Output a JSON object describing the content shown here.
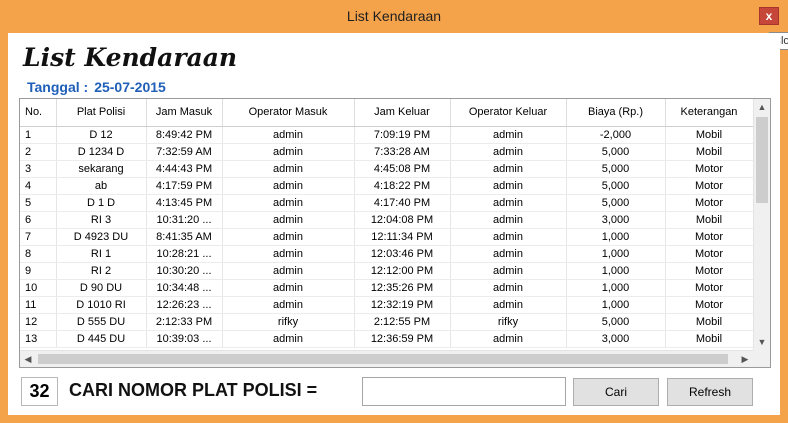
{
  "window": {
    "title": "List Kendaraan",
    "close_glyph": "x",
    "tooltip_fragment": "Clo"
  },
  "header": {
    "heading": "List Kendaraan",
    "date_label": "Tanggal :",
    "date_value": "25-07-2015"
  },
  "table": {
    "columns": [
      "No.",
      "Plat Polisi",
      "Jam Masuk",
      "Operator Masuk",
      "Jam Keluar",
      "Operator Keluar",
      "Biaya (Rp.)",
      "Keterangan"
    ],
    "rows": [
      [
        "1",
        "D 12",
        "8:49:42 PM",
        "admin",
        "7:09:19 PM",
        "admin",
        "-2,000",
        "Mobil"
      ],
      [
        "2",
        "D 1234 D",
        "7:32:59 AM",
        "admin",
        "7:33:28 AM",
        "admin",
        "5,000",
        "Mobil"
      ],
      [
        "3",
        "sekarang",
        "4:44:43 PM",
        "admin",
        "4:45:08 PM",
        "admin",
        "5,000",
        "Motor"
      ],
      [
        "4",
        "ab",
        "4:17:59 PM",
        "admin",
        "4:18:22 PM",
        "admin",
        "5,000",
        "Motor"
      ],
      [
        "5",
        "D 1 D",
        "4:13:45 PM",
        "admin",
        "4:17:40 PM",
        "admin",
        "5,000",
        "Motor"
      ],
      [
        "6",
        "RI 3",
        "10:31:20 ...",
        "admin",
        "12:04:08 PM",
        "admin",
        "3,000",
        "Mobil"
      ],
      [
        "7",
        "D 4923 DU",
        "8:41:35 AM",
        "admin",
        "12:11:34 PM",
        "admin",
        "1,000",
        "Motor"
      ],
      [
        "8",
        "RI 1",
        "10:28:21 ...",
        "admin",
        "12:03:46 PM",
        "admin",
        "1,000",
        "Motor"
      ],
      [
        "9",
        "RI 2",
        "10:30:20 ...",
        "admin",
        "12:12:00 PM",
        "admin",
        "1,000",
        "Motor"
      ],
      [
        "10",
        "D 90 DU",
        "10:34:48 ...",
        "admin",
        "12:35:26 PM",
        "admin",
        "1,000",
        "Motor"
      ],
      [
        "11",
        "D 1010 RI",
        "12:26:23 ...",
        "admin",
        "12:32:19 PM",
        "admin",
        "1,000",
        "Motor"
      ],
      [
        "12",
        "D 555 DU",
        "2:12:33 PM",
        "rifky",
        "2:12:55 PM",
        "rifky",
        "5,000",
        "Mobil"
      ],
      [
        "13",
        "D 445 DU",
        "10:39:03 ...",
        "admin",
        "12:36:59 PM",
        "admin",
        "3,000",
        "Mobil"
      ]
    ]
  },
  "footer": {
    "count": "32",
    "search_label": "CARI NOMOR PLAT POLISI =",
    "search_value": "",
    "cari_label": "Cari",
    "refresh_label": "Refresh"
  },
  "icons": {
    "scroll_up": "▲",
    "scroll_down": "▼",
    "scroll_left": "◀",
    "scroll_right": "▶"
  },
  "colors": {
    "title_bar": "#f5a34b",
    "close_button": "#c7463a",
    "date_text": "#1f5fb8"
  }
}
